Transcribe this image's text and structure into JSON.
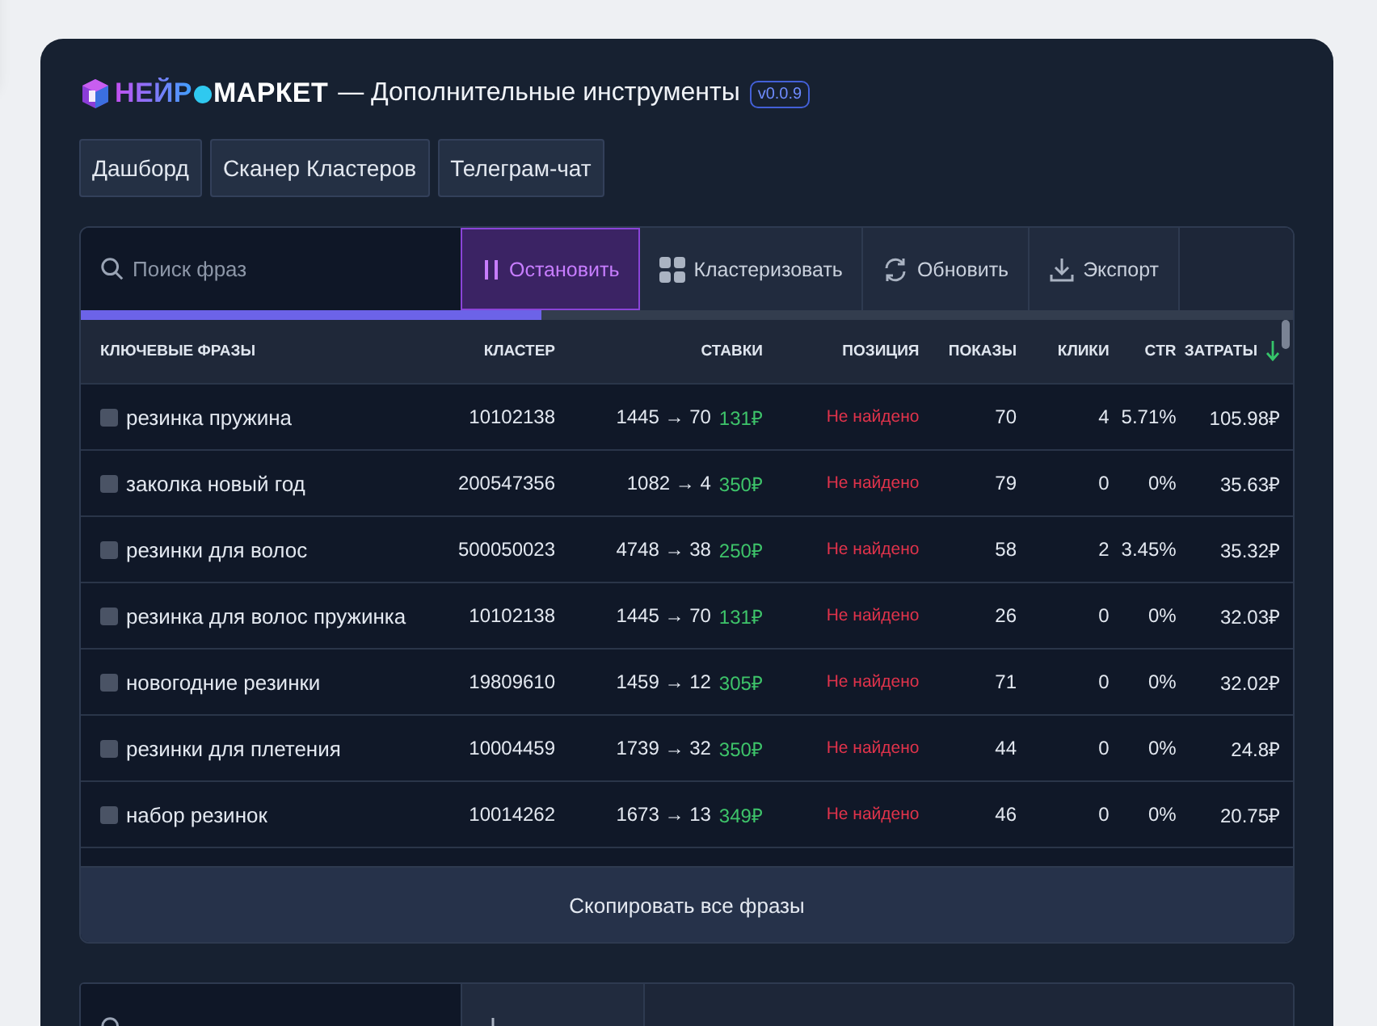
{
  "header": {
    "brand_left": "НЕЙР",
    "brand_right": "МАРКЕТ",
    "title": "— Дополнительные инструменты",
    "version": "v0.0.9"
  },
  "tabs": [
    {
      "label": "Дашборд",
      "selected": false
    },
    {
      "label": "Сканер Кластеров",
      "selected": false
    },
    {
      "label": "Телеграм-чат",
      "selected": false
    }
  ],
  "toolbar": {
    "search": {
      "placeholder": "Поиск фраз"
    },
    "buttons": [
      {
        "label": "Остановить",
        "kind": "pause",
        "active": true
      },
      {
        "label": "Кластеризовать",
        "kind": "grid",
        "active": false
      },
      {
        "label": "Обновить",
        "kind": "refresh",
        "active": false
      },
      {
        "label": "Экспорт",
        "kind": "download",
        "active": false
      }
    ],
    "progress": {
      "level": 0.38
    }
  },
  "table": {
    "columns": [
      {
        "label": "КЛЮЧЕВЫЕ ФРАЗЫ",
        "sorted": false
      },
      {
        "label": "КЛАСТЕР",
        "sorted": false
      },
      {
        "label": "СТАВКИ",
        "sorted": false
      },
      {
        "label": "ПОЗИЦИЯ",
        "sorted": false
      },
      {
        "label": "ПОКАЗЫ",
        "sorted": false
      },
      {
        "label": "КЛИКИ",
        "sorted": false
      },
      {
        "label": "CTR",
        "sorted": false
      },
      {
        "label": "ЗАТРАТЫ",
        "sorted": true
      }
    ],
    "rows": [
      {
        "checked": false,
        "phrase": "резинка пружина",
        "cluster": "10102138",
        "bid": "1445 → 70",
        "price": "131₽",
        "position": "Не найдено",
        "shows": "70",
        "clicks": "4",
        "ctr": "5.71%",
        "cost": "105.98₽"
      },
      {
        "checked": false,
        "phrase": "заколка новый год",
        "cluster": "200547356",
        "bid": "1082 → 4",
        "price": "350₽",
        "position": "Не найдено",
        "shows": "79",
        "clicks": "0",
        "ctr": "0%",
        "cost": "35.63₽"
      },
      {
        "checked": false,
        "phrase": "резинки для волос",
        "cluster": "500050023",
        "bid": "4748 → 38",
        "price": "250₽",
        "position": "Не найдено",
        "shows": "58",
        "clicks": "2",
        "ctr": "3.45%",
        "cost": "35.32₽"
      },
      {
        "checked": false,
        "phrase": "резинка для волос пружинка",
        "cluster": "10102138",
        "bid": "1445 → 70",
        "price": "131₽",
        "position": "Не найдено",
        "shows": "26",
        "clicks": "0",
        "ctr": "0%",
        "cost": "32.03₽"
      },
      {
        "checked": false,
        "phrase": "новогодние резинки",
        "cluster": "19809610",
        "bid": "1459 → 12",
        "price": "305₽",
        "position": "Не найдено",
        "shows": "71",
        "clicks": "0",
        "ctr": "0%",
        "cost": "32.02₽"
      },
      {
        "checked": false,
        "phrase": "резинки для плетения",
        "cluster": "10004459",
        "bid": "1739 → 32",
        "price": "350₽",
        "position": "Не найдено",
        "shows": "44",
        "clicks": "0",
        "ctr": "0%",
        "cost": "24.8₽"
      },
      {
        "checked": false,
        "phrase": "набор резинок",
        "cluster": "10014262",
        "bid": "1673 → 13",
        "price": "349₽",
        "position": "Не найдено",
        "shows": "46",
        "clicks": "0",
        "ctr": "0%",
        "cost": "20.75₽"
      }
    ],
    "copy_button": "Скопировать все фразы"
  }
}
